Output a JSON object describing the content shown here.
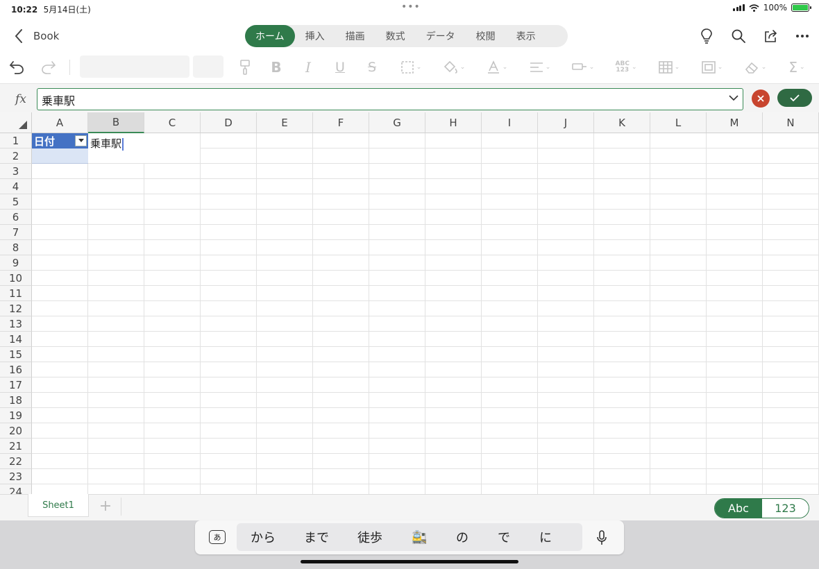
{
  "status": {
    "time": "10:22",
    "date": "5月14日(土)",
    "battery": "100%"
  },
  "header": {
    "title": "Book",
    "tabs": [
      {
        "label": "ホーム",
        "active": true
      },
      {
        "label": "挿入",
        "active": false
      },
      {
        "label": "描画",
        "active": false
      },
      {
        "label": "数式",
        "active": false
      },
      {
        "label": "データ",
        "active": false
      },
      {
        "label": "校閲",
        "active": false
      },
      {
        "label": "表示",
        "active": false
      }
    ]
  },
  "toolbar": {
    "number_format_label": "ABC\n123"
  },
  "formula": {
    "fx_label": "fx",
    "value": "乗車駅"
  },
  "grid": {
    "columns": [
      "A",
      "B",
      "C",
      "D",
      "E",
      "F",
      "G",
      "H",
      "I",
      "J",
      "K",
      "L",
      "M",
      "N"
    ],
    "selected_column": "B",
    "rows": [
      "1",
      "2",
      "3",
      "4",
      "5",
      "6",
      "7",
      "8",
      "9",
      "10",
      "11",
      "12",
      "13",
      "14",
      "15",
      "16",
      "17",
      "18",
      "19",
      "20",
      "21",
      "22",
      "23",
      "24"
    ],
    "cell_a1": "日付",
    "edit_value": "乗車駅",
    "header_color": "#4472c4"
  },
  "sheets": {
    "tabs": [
      "Sheet1"
    ],
    "add_label": "+",
    "mode_abc": "Abc",
    "mode_123": "123"
  },
  "keyboard": {
    "kana_label": "あ",
    "suggestions": [
      "から",
      "まで",
      "徒歩",
      "🚉",
      "の",
      "で",
      "に"
    ]
  },
  "colors": {
    "accent": "#2f7a4a",
    "cancel": "#c8452f"
  }
}
